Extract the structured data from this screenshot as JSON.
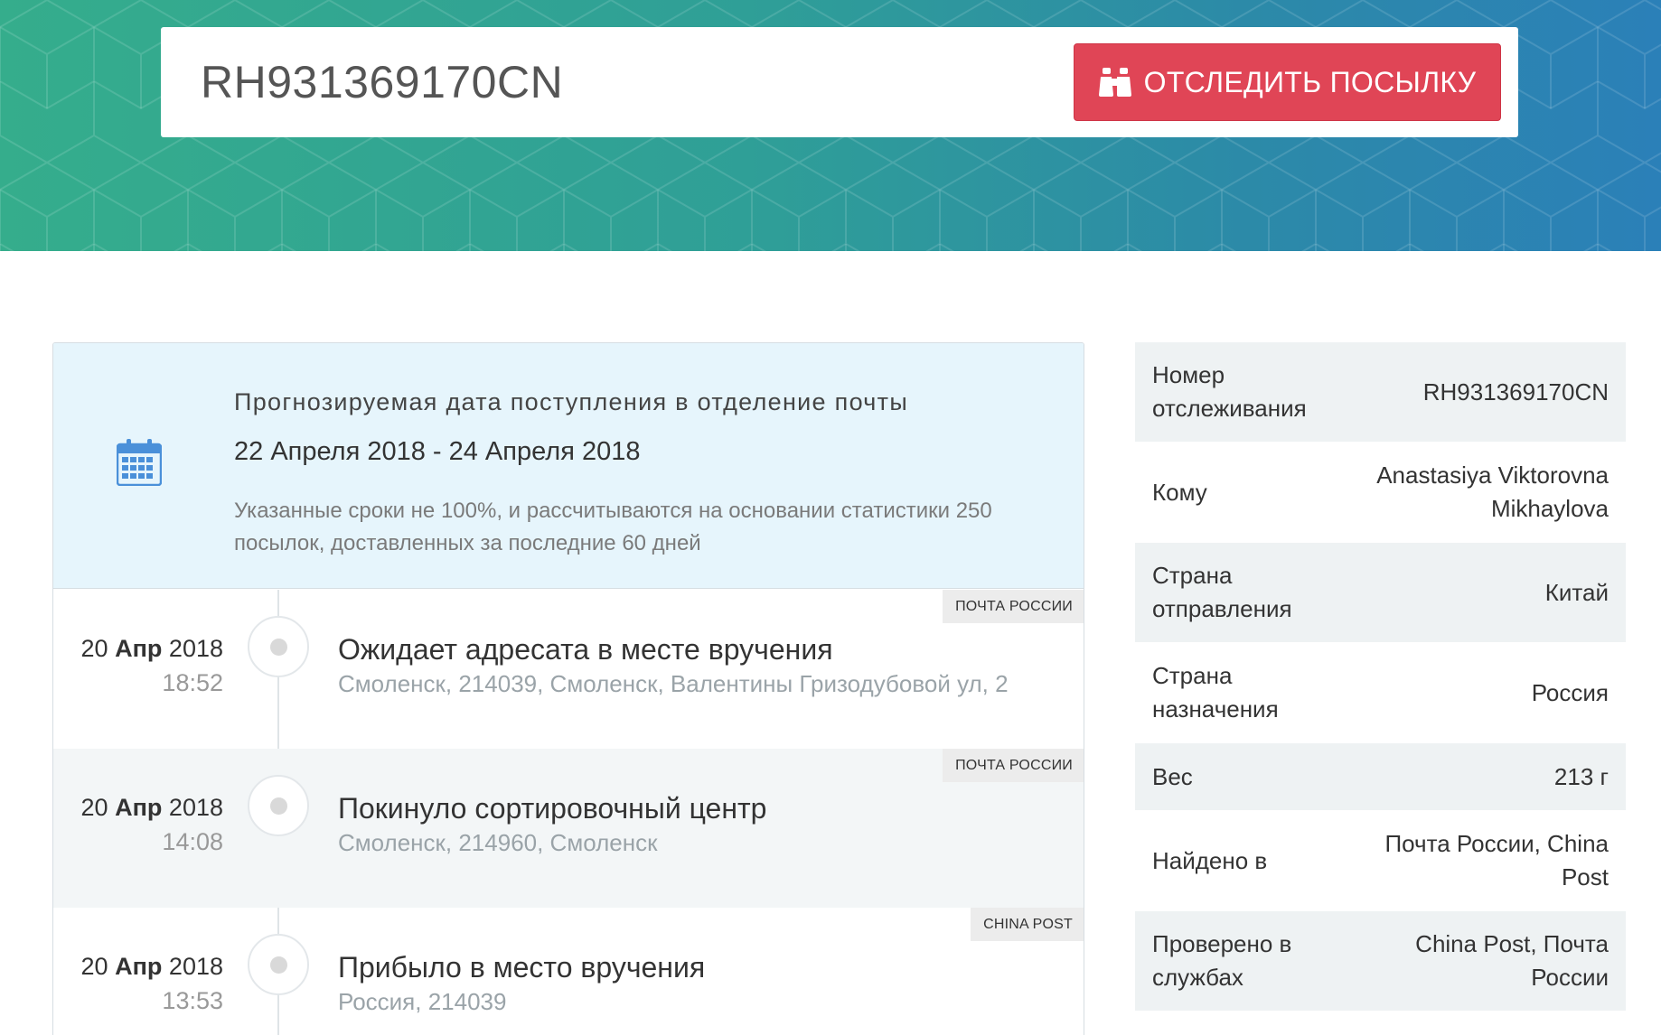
{
  "header": {
    "tracking_input_value": "RH931369170CN",
    "track_button_label": "ОТСЛЕДИТЬ ПОСЫЛКУ",
    "track_button_icon": "binoculars-icon",
    "accent_color": "#e04556"
  },
  "forecast": {
    "icon": "calendar-icon",
    "title": "Прогнозируемая дата поступления в отделение почты",
    "dates": "22 Апреля 2018 - 24 Апреля 2018",
    "note": "Указанные сроки не 100%, и рассчитываются на основании статистики 250 посылок, доставленных за последние 60 дней"
  },
  "events": [
    {
      "carrier": "ПОЧТА РОССИИ",
      "day": "20",
      "month": "Апр",
      "year": "2018",
      "time": "18:52",
      "title": "Ожидает адресата в месте вручения",
      "location": "Смоленск, 214039, Смоленск, Валентины Гризодубовой ул, 2"
    },
    {
      "carrier": "ПОЧТА РОССИИ",
      "day": "20",
      "month": "Апр",
      "year": "2018",
      "time": "14:08",
      "title": "Покинуло сортировочный центр",
      "location": "Смоленск, 214960, Смоленск"
    },
    {
      "carrier": "CHINA POST",
      "day": "20",
      "month": "Апр",
      "year": "2018",
      "time": "13:53",
      "title": "Прибыло в место вручения",
      "location": "Россия, 214039"
    }
  ],
  "info": [
    {
      "label": "Номер отслеживания",
      "value": "RH931369170CN"
    },
    {
      "label": "Кому",
      "value": "Anastasiya Viktorovna Mikhaylova"
    },
    {
      "label": "Страна отправления",
      "value": "Китай"
    },
    {
      "label": "Страна назначения",
      "value": "Россия"
    },
    {
      "label": "Вес",
      "value": "213 г"
    },
    {
      "label": "Найдено в",
      "value": "Почта России, China Post"
    },
    {
      "label": "Проверено в службах",
      "value": "China Post, Почта России"
    }
  ]
}
